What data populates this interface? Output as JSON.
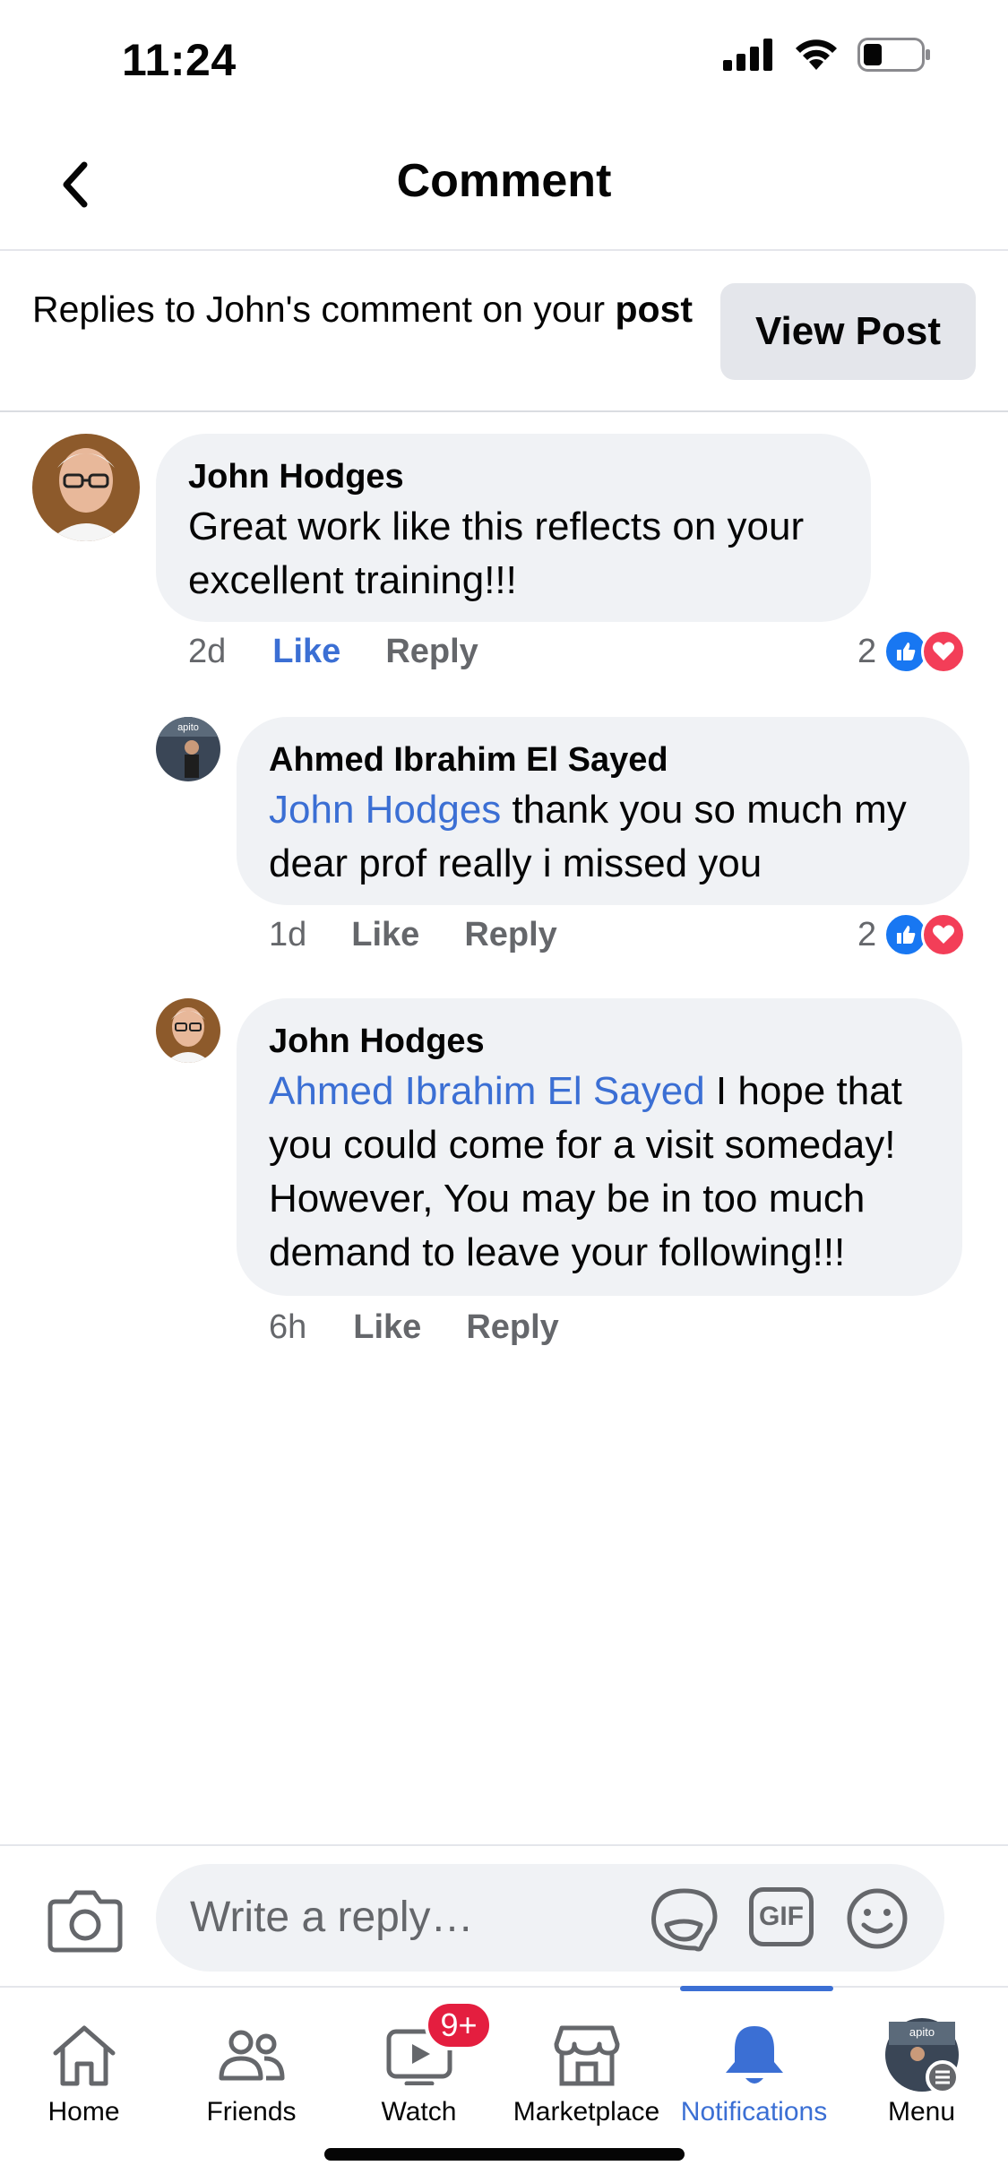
{
  "status_bar": {
    "time": "11:24"
  },
  "header": {
    "title": "Comment"
  },
  "context": {
    "prefix": "Replies to John's comment on your ",
    "bold": "post",
    "view_post_label": "View Post"
  },
  "comments": [
    {
      "author": "John Hodges",
      "mention": "",
      "text": "Great work like this reflects on your excellent training!!!",
      "time": "2d",
      "like_label": "Like",
      "reply_label": "Reply",
      "reaction_count": "2"
    },
    {
      "author": "Ahmed Ibrahim El Sayed",
      "mention": "John Hodges",
      "text": " thank you so much my dear prof really i missed you",
      "time": "1d",
      "like_label": "Like",
      "reply_label": "Reply",
      "reaction_count": "2"
    },
    {
      "author": "John Hodges",
      "mention": "Ahmed Ibrahim El Sayed",
      "text": " I hope that you could come for a visit someday! However, You may be in too much demand to leave your following!!!",
      "time": "6h",
      "like_label": "Like",
      "reply_label": "Reply"
    }
  ],
  "composer": {
    "placeholder": "Write a reply…",
    "gif_label": "GIF"
  },
  "tabs": [
    {
      "label": "Home",
      "icon": "home-icon"
    },
    {
      "label": "Friends",
      "icon": "friends-icon"
    },
    {
      "label": "Watch",
      "icon": "watch-icon",
      "badge": "9+"
    },
    {
      "label": "Marketplace",
      "icon": "marketplace-icon"
    },
    {
      "label": "Notifications",
      "icon": "bell-icon",
      "active": true
    },
    {
      "label": "Menu",
      "icon": "menu-avatar"
    }
  ],
  "colors": {
    "accent": "#3b6fd4",
    "bubble": "#f0f2f5",
    "badge": "#e41e3f",
    "secondary_text": "#65676b"
  }
}
